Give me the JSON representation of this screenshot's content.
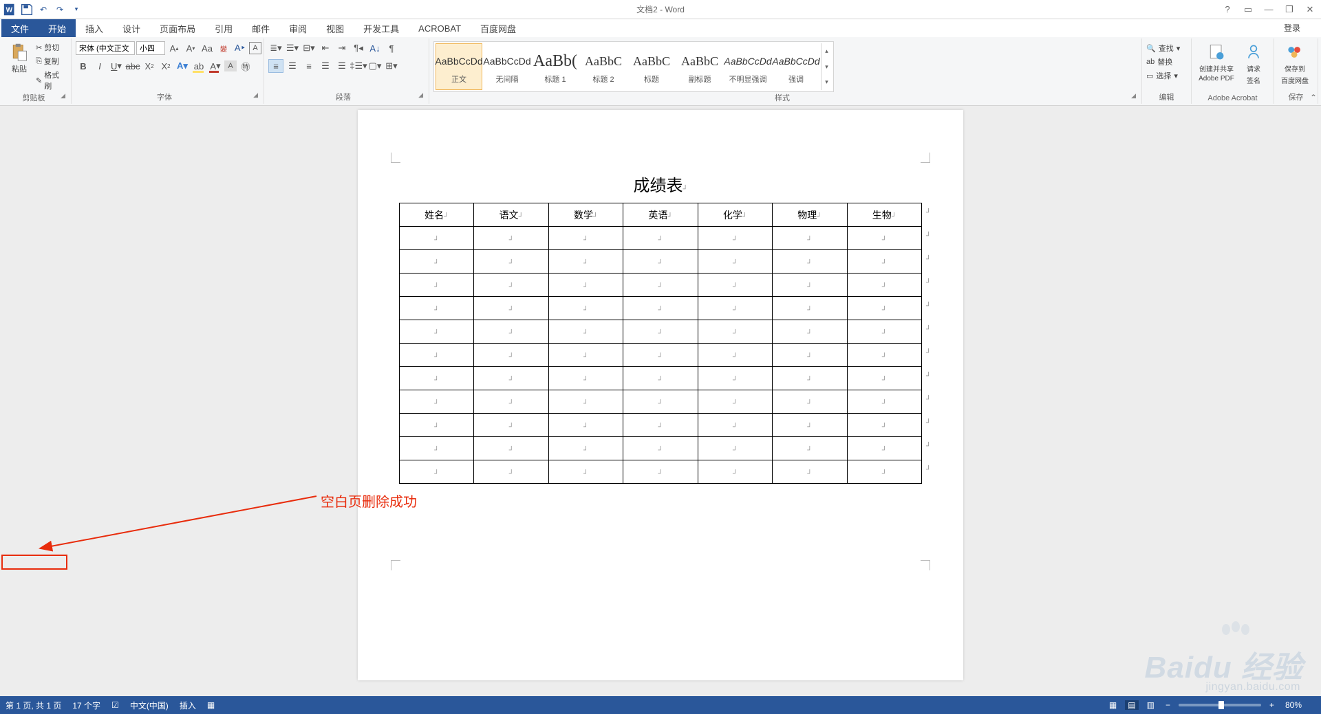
{
  "app": {
    "title": "文档2 - Word",
    "login": "登录"
  },
  "tabs": {
    "file": "文件",
    "home": "开始",
    "insert": "插入",
    "design": "设计",
    "layout": "页面布局",
    "references": "引用",
    "mailings": "邮件",
    "review": "审阅",
    "view": "视图",
    "dev": "开发工具",
    "acrobat": "ACROBAT",
    "baidu": "百度网盘"
  },
  "ribbon": {
    "clipboard": {
      "label": "剪贴板",
      "paste": "粘贴",
      "cut": "剪切",
      "copy": "复制",
      "painter": "格式刷"
    },
    "font": {
      "label": "字体",
      "name": "宋体 (中文正文",
      "size": "小四"
    },
    "paragraph": {
      "label": "段落"
    },
    "styles": {
      "label": "样式",
      "items": [
        {
          "preview": "AaBbCcDd",
          "name": "正文",
          "cls": "",
          "sel": true
        },
        {
          "preview": "AaBbCcDd",
          "name": "无间隔",
          "cls": ""
        },
        {
          "preview": "AaBb(",
          "name": "标题 1",
          "cls": "hdg",
          "size": "24px"
        },
        {
          "preview": "AaBbC",
          "name": "标题 2",
          "cls": "hdg",
          "size": "18px"
        },
        {
          "preview": "AaBbC",
          "name": "标题",
          "cls": "hdg",
          "size": "18px"
        },
        {
          "preview": "AaBbC",
          "name": "副标题",
          "cls": "hdg",
          "size": "18px"
        },
        {
          "preview": "AaBbCcDd",
          "name": "不明显强调",
          "cls": "",
          "ital": true
        },
        {
          "preview": "AaBbCcDd",
          "name": "强调",
          "cls": "",
          "ital": true
        }
      ]
    },
    "editing": {
      "label": "编辑",
      "find": "查找",
      "replace": "替换",
      "select": "选择"
    },
    "acrobat": {
      "label": "Adobe Acrobat",
      "create": "创建并共享",
      "pdf": "Adobe PDF",
      "sign": "请求",
      "sign2": "签名"
    },
    "save": {
      "label": "保存",
      "btn1": "保存到",
      "btn2": "百度网盘"
    }
  },
  "doc": {
    "title": "成绩表",
    "headers": [
      "姓名",
      "语文",
      "数学",
      "英语",
      "化学",
      "物理",
      "生物"
    ],
    "rows": 11
  },
  "annotation": {
    "text": "空白页删除成功"
  },
  "status": {
    "page": "第 1 页, 共 1 页",
    "words": "17 个字",
    "lang": "中文(中国)",
    "mode": "插入",
    "zoom": "80%"
  },
  "watermark": {
    "brand": "Baidu 经验",
    "url": "jingyan.baidu.com"
  }
}
